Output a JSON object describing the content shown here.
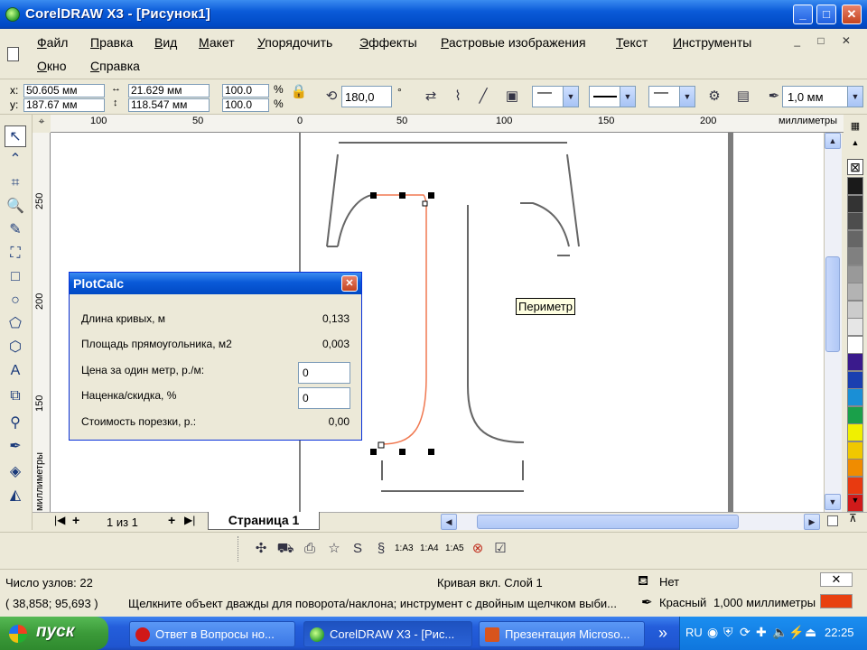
{
  "window": {
    "title": "CorelDRAW X3 - [Рисунок1]",
    "min": "_",
    "max": "□",
    "close": "✕"
  },
  "menu": {
    "items": [
      "Файл",
      "Правка",
      "Вид",
      "Макет",
      "Упорядочить",
      "Эффекты",
      "Растровые изображения",
      "Текст",
      "Инструменты",
      "Окно",
      "Справка"
    ],
    "mdi_controls": "_ □ ✕"
  },
  "propbar": {
    "x_label": "x:",
    "x_value": "50.605 мм",
    "y_label": "y:",
    "y_value": "187.67 мм",
    "width_value": "21.629 мм",
    "height_value": "118.547 мм",
    "scale_x": "100.0",
    "scale_y": "100.0",
    "percent": "%",
    "rotation": "180,0",
    "degree": "°",
    "outline_width": "1,0 мм"
  },
  "ruler": {
    "unit": "миллиметры",
    "h_labels": [
      "100",
      "50",
      "0",
      "50",
      "100",
      "150",
      "200"
    ],
    "v_labels": [
      "250",
      "200",
      "150"
    ]
  },
  "pagebar": {
    "page_count": "1 из 1",
    "page_tab": "Страница 1"
  },
  "bottom_toolbar": {
    "a3": "1:A3",
    "a4": "1:A4",
    "a5": "1:A5"
  },
  "status": {
    "nodes": "Число узлов: 22",
    "object": "Кривая вкл. Слой 1",
    "fill_label": "Нет",
    "coords": "( 38,858; 95,693 )",
    "hint": "Щелкните объект дважды для поворота/наклона; инструмент с двойным щелчком выби...",
    "outline_label": "Красный",
    "outline_width": "1,000 миллиметры",
    "outline_color": "#e84010"
  },
  "taskbar": {
    "start": "пуск",
    "tasks": [
      {
        "label": "Ответ в Вопросы но..."
      },
      {
        "label": "CorelDRAW X3 - [Рис..."
      },
      {
        "label": "Презентация Microso..."
      }
    ],
    "lang": "RU",
    "clock": "22:25"
  },
  "plotcalc": {
    "title": "PlotCalc",
    "rows": [
      {
        "label": "Длина кривых, м",
        "value": "0,133"
      },
      {
        "label": "Площадь прямоугольника, м2",
        "value": "0,003"
      },
      {
        "label": "Цена за один метр, р./м:",
        "value": "0"
      },
      {
        "label": "Наценка/скидка, %",
        "value": "0"
      },
      {
        "label": "Стоимость порезки, р.:",
        "value": "0,00"
      }
    ]
  },
  "tooltip": "Периметр",
  "palette": [
    "#ffffff",
    "#1a1a1a",
    "#333333",
    "#4d4d4d",
    "#666666",
    "#808080",
    "#999999",
    "#b3b3b3",
    "#cccccc",
    "#e6e6e6",
    "#ffffff",
    "#3a1a8c",
    "#1a3fb0",
    "#1a8fd6",
    "#1aa04a",
    "#f0f000",
    "#f0c800",
    "#f08c00",
    "#e83a10",
    "#d01a1a"
  ],
  "colors": {
    "selected_curve": "#f07850",
    "curve": "#666666"
  }
}
